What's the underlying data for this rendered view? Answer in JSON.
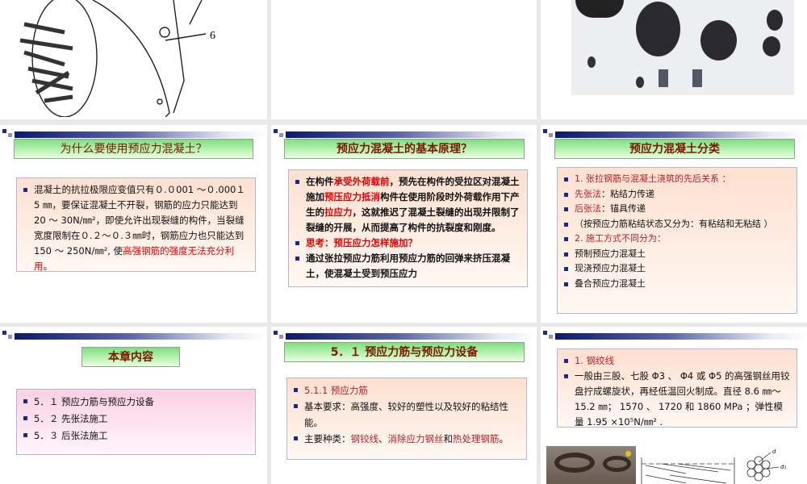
{
  "slides": [
    {
      "figure_label": "6"
    },
    {},
    {},
    {
      "title": "为什么要使用预应力混凝土？",
      "body": [
        "混凝土的抗拉极限应变值只有０.０001 ～０.000１5 ㎜，要保证混凝土不开裂，钢筋的应力只能达到 20 ～ 30N/㎜²，即使允许出现裂缝的构件，当裂缝宽度限制在０.２～０.３㎜时，钢筋应力也只能达到 150 ～ 250N/㎜², 使",
        "高强钢筋的强度无法充分利用",
        "。"
      ]
    },
    {
      "title": "预应力混凝土的基本原理？",
      "p1": [
        "在构件",
        "承受外荷载前",
        "，预先在构件的受拉区对混凝土施加",
        "预压应力抵消",
        "构件在使用阶段时外荷载作用下产生的",
        "拉应力",
        "，这就推迟了混凝土裂缝的出现并限制了裂缝的开展，从而提高了构件的抗裂度和刚度。"
      ],
      "p2": "思考：预压应力怎样施加？",
      "p3": "通过张拉预应力筋利用预应力筋的回弹来挤压混凝土，使混凝土受到预压应力"
    },
    {
      "title": "预应力混凝土分类",
      "items": [
        [
          "1. 张拉钢筋与混凝土浇筑的先后关系 ：",
          ""
        ],
        [
          "先张法",
          "：粘结力传递"
        ],
        [
          "后张法",
          "：锚具传递"
        ],
        [
          "",
          "（按预应力筋粘结状态又分为：有粘结和无粘结 ）"
        ],
        [
          "2. 施工方式不同分为：",
          ""
        ],
        [
          "",
          "预制预应力混凝土"
        ],
        [
          "",
          "现浇预应力混凝土"
        ],
        [
          "",
          "叠合预应力混凝土"
        ]
      ]
    },
    {
      "title": "本章内容",
      "items": [
        "5．１ 预应力筋与预应力设备",
        "5．２ 先张法施工",
        "5．３ 后张法施工"
      ]
    },
    {
      "title": "5．１ 预应力筋与预应力设备",
      "i1": "5.1.1  预应力筋",
      "i2": "  基本要求：高强度、较好的塑性以及较好的粘结性能。",
      "i3": [
        "主要种类：",
        "钢铰线",
        "、",
        "消除应力钢丝",
        "和",
        "热处理钢筋",
        "。"
      ]
    },
    {
      "i1": "1. 钢绞线",
      "i2": "一般由三股、七股 Φ3 、 Φ4  或 Φ5  的高强钢丝用铰盘拧成螺旋状，再经低温回火制成。直径 8.6 ㎜～ 15.2 ㎜；   1570 、   1720 和 1860 MPa ；弹性模量 1.95 ×10⁵N/㎜² .",
      "d_label": "d",
      "d1_label": "d₁"
    }
  ]
}
